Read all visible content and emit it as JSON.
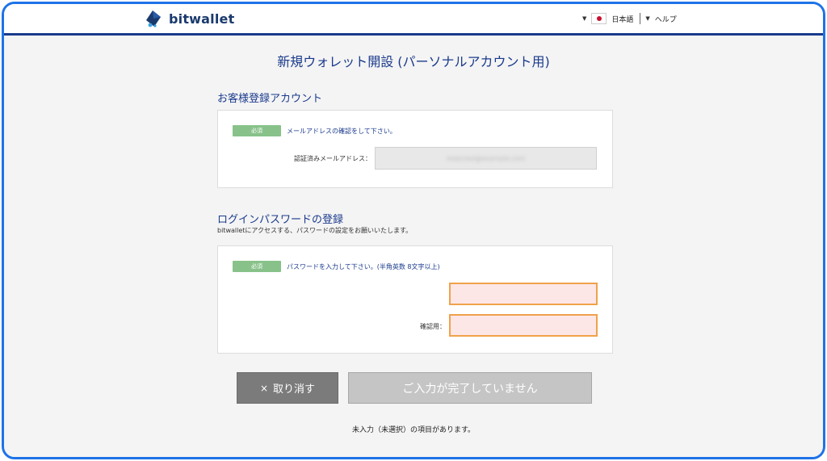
{
  "header": {
    "logo_text": "bitwallet",
    "language": "日本語",
    "help": "ヘルプ",
    "colors": {
      "header_border": "#1a3a8c",
      "logo": "#1a3a6e"
    }
  },
  "page_title": "新規ウォレット開設 (パーソナルアカウント用)",
  "customer_section": {
    "heading": "お客様登録アカウント",
    "required_badge": "必須",
    "note": "メールアドレスの確認をして下さい。",
    "email_label": "認証済みメールアドレス：",
    "email_value": "redacted@example.com"
  },
  "password_section": {
    "heading": "ログインパスワードの登録",
    "subtitle": "bitwalletにアクセスする、パスワードの設定をお願いいたします。",
    "required_badge": "必須",
    "note": "パスワードを入力して下さい。(半角英数 8文字以上)",
    "confirm_label": "確認用："
  },
  "buttons": {
    "cancel_label": "取り消す",
    "cancel_icon": "×",
    "submit_label": "ご入力が完了していません"
  },
  "footer_note": "未入力（未選択）の項目があります。",
  "colors": {
    "accent": "#1e73e8",
    "required_badge": "#88c28a",
    "field_error_bg": "#fde6e6",
    "field_error_border": "#f0a24a"
  }
}
